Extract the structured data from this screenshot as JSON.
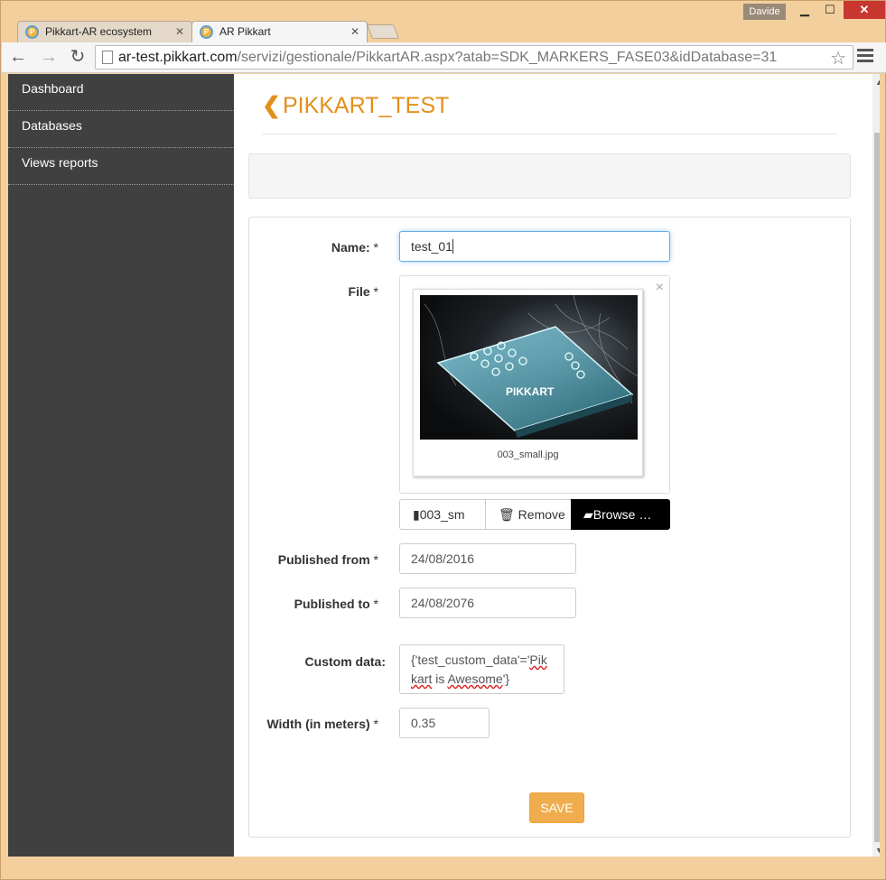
{
  "window": {
    "user": "Davide",
    "minimize_glyph": "▁",
    "maximize_glyph": "☐",
    "close_glyph": "✕"
  },
  "tabs": [
    {
      "label": "Pikkart-AR ecosystem",
      "close": "✕",
      "icon": "pikkart-logo-icon"
    },
    {
      "label": "AR Pikkart",
      "close": "✕",
      "icon": "pikkart-logo-icon"
    }
  ],
  "toolbar": {
    "url_host": "ar-test.pikkart.com",
    "url_path": "/servizi/gestionale/PikkartAR.aspx?atab=SDK_MARKERS_FASE03&idDatabase=31",
    "back": "←",
    "forward": "→",
    "reload": "↻",
    "star": "☆"
  },
  "sidebar": {
    "items": [
      {
        "label": "Dashboard"
      },
      {
        "label": "Databases"
      },
      {
        "label": "Views reports"
      }
    ]
  },
  "page": {
    "back_chevron": "❮",
    "title": "PIKKART_TEST"
  },
  "form": {
    "required_mark": "*",
    "name_label": "Name:",
    "name_value": "test_01",
    "file_label": "File",
    "file_close": "×",
    "file_caption": "003_small.jpg",
    "thumb_brand": "PIKKART",
    "file_button_name": "003_sm",
    "remove_label": "Remove",
    "browse_label": "Browse …",
    "published_from_label": "Published from",
    "published_from_value": "24/08/2016",
    "published_to_label": "Published to",
    "published_to_value": "24/08/2076",
    "custom_data_label": "Custom data:",
    "custom_data_line1_a": "{'test_custom_data'='",
    "custom_data_line1_b": "Pik",
    "custom_data_line2_a": "kart",
    "custom_data_line2_b": " is ",
    "custom_data_line2_c": "Awesome",
    "custom_data_line2_d": "'}",
    "width_label": "Width (in meters)",
    "width_value": "0.35",
    "save_label": "SAVE"
  },
  "colors": {
    "accent": "#e38f1c",
    "sidebar": "#404040",
    "save": "#f0ad4e",
    "close_button": "#c7372f"
  }
}
